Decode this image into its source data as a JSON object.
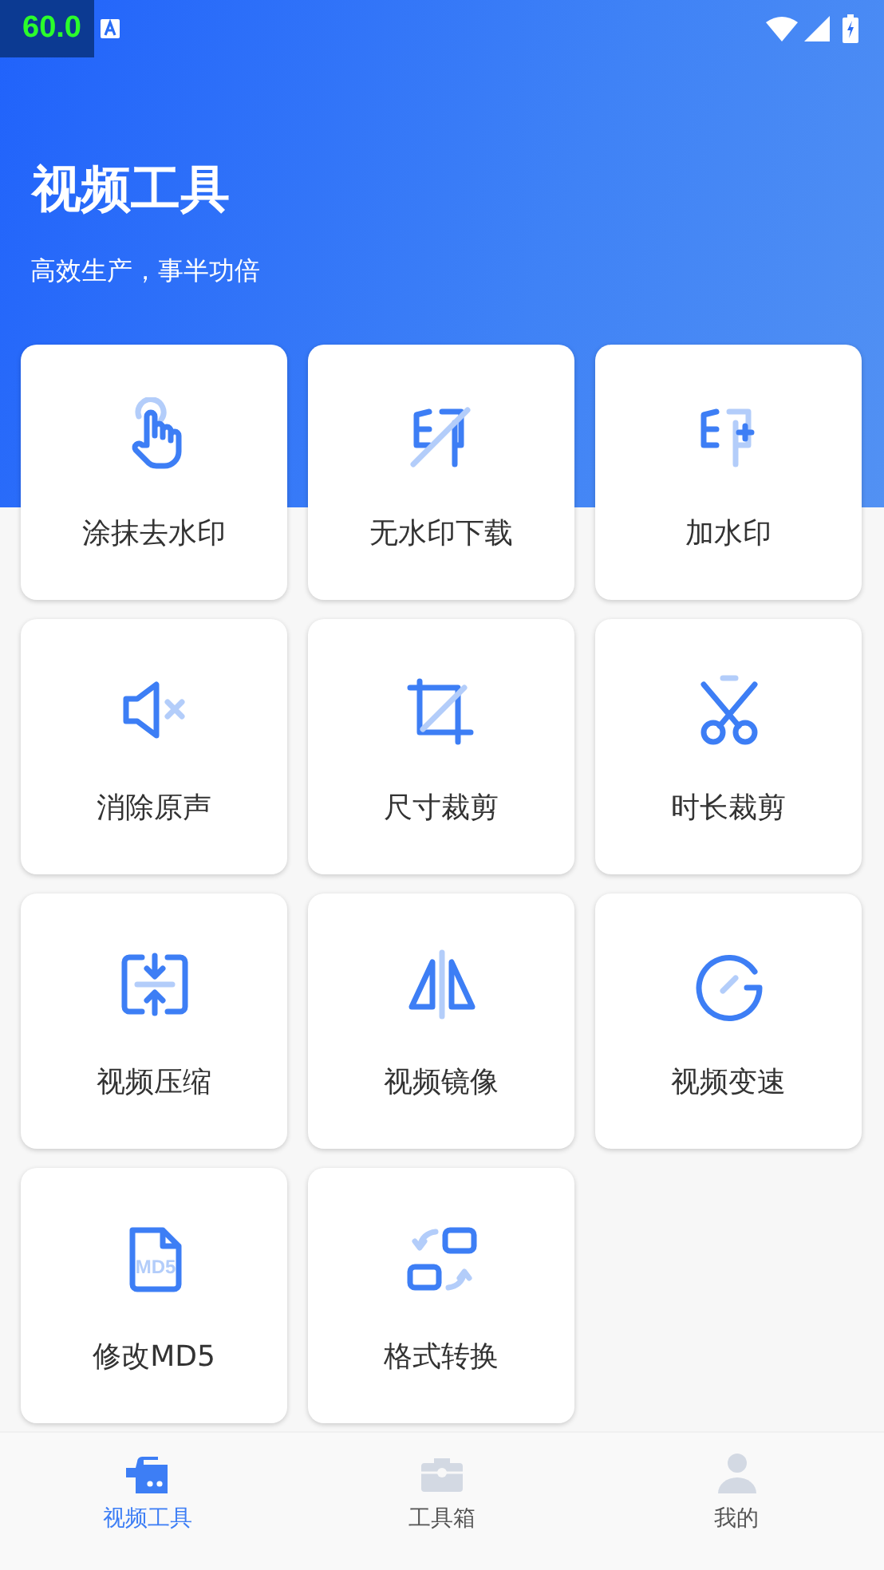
{
  "status_bar": {
    "fps": "60.0"
  },
  "header": {
    "title": "视频工具",
    "subtitle": "高效生产，事半功倍"
  },
  "tools": [
    {
      "label": "涂抹去水印",
      "kind": "hand"
    },
    {
      "label": "无水印下载",
      "kind": "stampoff"
    },
    {
      "label": "加水印",
      "kind": "stampadd"
    },
    {
      "label": "消除原声",
      "kind": "mute"
    },
    {
      "label": "尺寸裁剪",
      "kind": "crop"
    },
    {
      "label": "时长裁剪",
      "kind": "scissors"
    },
    {
      "label": "视频压缩",
      "kind": "compress"
    },
    {
      "label": "视频镜像",
      "kind": "mirror"
    },
    {
      "label": "视频变速",
      "kind": "speed"
    },
    {
      "label": "修改MD5",
      "kind": "file",
      "icon_text": "MD5"
    },
    {
      "label": "格式转换",
      "kind": "convert"
    }
  ],
  "nav": [
    {
      "label": "视频工具",
      "kind": "camera",
      "selected": true
    },
    {
      "label": "工具箱",
      "kind": "toolbox",
      "selected": false
    },
    {
      "label": "我的",
      "kind": "person",
      "selected": false
    }
  ]
}
